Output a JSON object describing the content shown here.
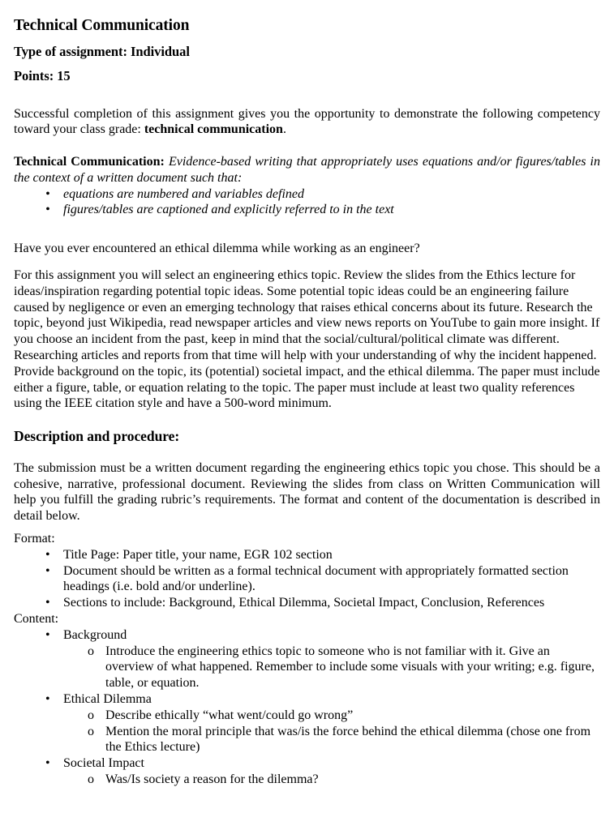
{
  "document": {
    "title": "Technical Communication",
    "assignment_type": "Type of assignment: Individual",
    "points": "Points: 15",
    "intro": {
      "text_before_bold": "Successful completion of this assignment gives you the opportunity to demonstrate the following competency toward your class grade: ",
      "bold_term": "technical communication",
      "text_after_bold": "."
    },
    "competency": {
      "label": "Technical Communication:",
      "definition": " Evidence-based writing that appropriately uses equations and/or figures/tables in the context of a written document such that:",
      "criteria": [
        "equations are numbered and variables defined",
        "figures/tables are captioned and explicitly referred to in the text"
      ]
    },
    "hook_question": "Have you ever encountered an ethical dilemma while working as an engineer?",
    "assignment_paragraph": "For this assignment you will select an engineering ethics topic. Review the slides from the Ethics lecture for ideas/inspiration regarding potential topic ideas. Some potential topic ideas could be an engineering failure caused by negligence or even an emerging technology that raises ethical concerns about its future. Research the topic, beyond just Wikipedia, read newspaper articles and view news reports on YouTube to gain more insight. If you choose an incident from the past, keep in mind that the social/cultural/political climate was different. Researching articles and reports from that time will help with your understanding of why the incident happened. Provide background on the topic, its (potential) societal impact, and the ethical dilemma. The paper must include either a figure, table, or equation relating to the topic. The paper must include at least two quality references using the IEEE citation style and have a 500-word minimum.",
    "description_heading": "Description and procedure:",
    "description_paragraph": "The submission must be a written document regarding the engineering ethics topic you chose. This should be a cohesive, narrative, professional document. Reviewing the slides from class on Written Communication will help you fulfill the grading rubric’s requirements. The format and content of the documentation is described in detail below.",
    "format": {
      "label": "Format:",
      "items": [
        "Title Page:  Paper title, your name, EGR 102 section",
        "Document should be written as a formal technical document with appropriately formatted section headings (i.e. bold and/or underline).",
        "Sections to include: Background, Ethical Dilemma, Societal Impact, Conclusion, References"
      ]
    },
    "content": {
      "label": "Content:",
      "sections": [
        {
          "heading": "Background",
          "subitems": [
            "Introduce the engineering ethics topic to someone who is not familiar with it. Give an overview of what happened. Remember to include some visuals with your writing; e.g. figure, table, or equation."
          ]
        },
        {
          "heading": "Ethical Dilemma",
          "subitems": [
            "Describe ethically “what went/could go wrong”",
            "Mention the moral principle that was/is the force behind the ethical dilemma (chose one from the Ethics lecture)"
          ]
        },
        {
          "heading": "Societal Impact",
          "subitems": [
            "Was/Is society a reason for the dilemma?"
          ]
        }
      ]
    },
    "markers": {
      "bullet_filled": "•",
      "bullet_hollow": "o"
    }
  }
}
